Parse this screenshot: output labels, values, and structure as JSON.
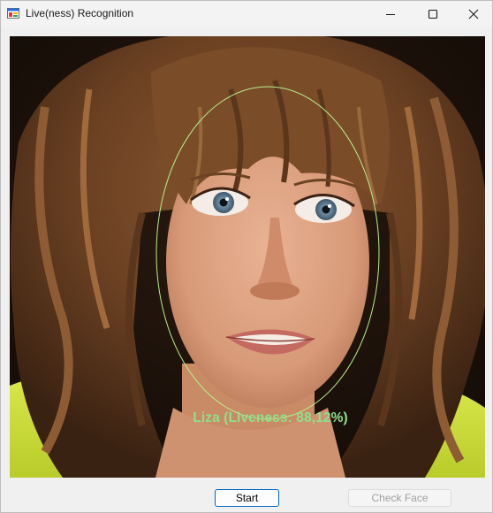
{
  "window": {
    "title": "Live(ness) Recognition",
    "icons": {
      "app": "app-icon",
      "minimize": "minimize-icon",
      "maximize": "maximize-icon",
      "close": "close-icon"
    }
  },
  "viewer": {
    "image_description": "camera-frame",
    "overlay_label": "Liza (Liveness: 88,12%)",
    "overlay_color": "#8fe08c",
    "face_outline_color": "#b8f08a"
  },
  "buttons": {
    "start_label": "Start",
    "check_face_label": "Check Face",
    "check_face_enabled": false
  },
  "colors": {
    "accent": "#0067c0",
    "window_bg": "#f0f0f0"
  }
}
